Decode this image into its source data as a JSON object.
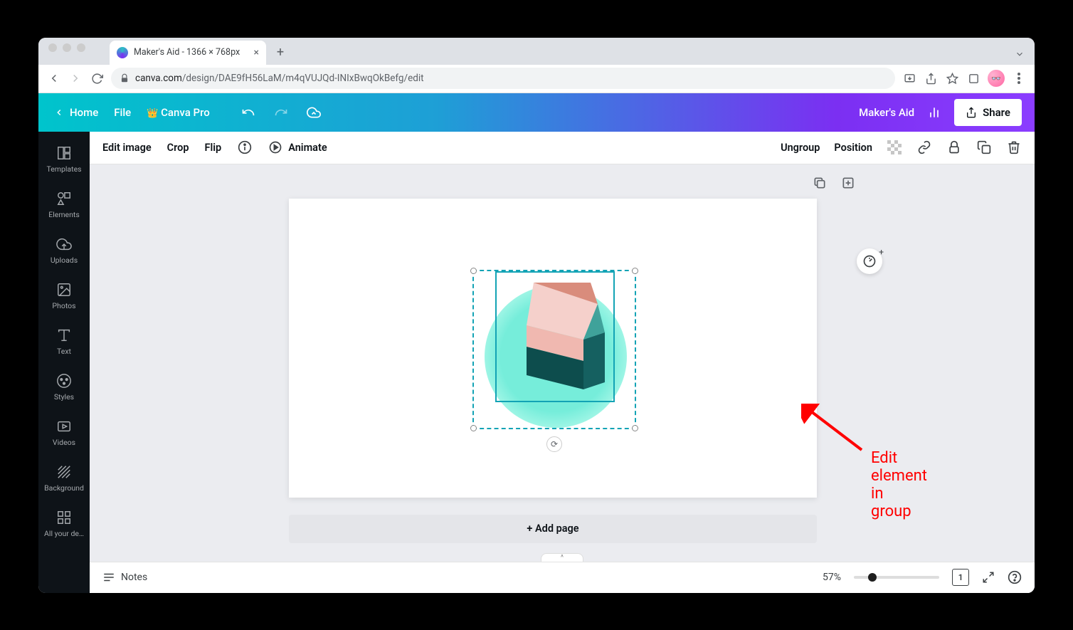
{
  "browser": {
    "tab_title": "Maker's Aid - 1366 × 768px",
    "url_host": "canva.com",
    "url_path": "/design/DAE9fH56LaM/m4qVUJQd-INIxBwqOkBefg/edit"
  },
  "topbar": {
    "home": "Home",
    "file": "File",
    "pro": "Canva Pro",
    "project_name": "Maker's Aid",
    "share": "Share"
  },
  "sidebar": {
    "items": [
      {
        "label": "Templates"
      },
      {
        "label": "Elements"
      },
      {
        "label": "Uploads"
      },
      {
        "label": "Photos"
      },
      {
        "label": "Text"
      },
      {
        "label": "Styles"
      },
      {
        "label": "Videos"
      },
      {
        "label": "Background"
      },
      {
        "label": "All your de…"
      }
    ]
  },
  "optionsbar": {
    "edit_image": "Edit image",
    "crop": "Crop",
    "flip": "Flip",
    "animate": "Animate",
    "ungroup": "Ungroup",
    "position": "Position"
  },
  "canvas": {
    "add_page": "+ Add page",
    "annotation": "Edit element in group"
  },
  "footer": {
    "notes": "Notes",
    "zoom": "57%",
    "page_number": "1"
  }
}
